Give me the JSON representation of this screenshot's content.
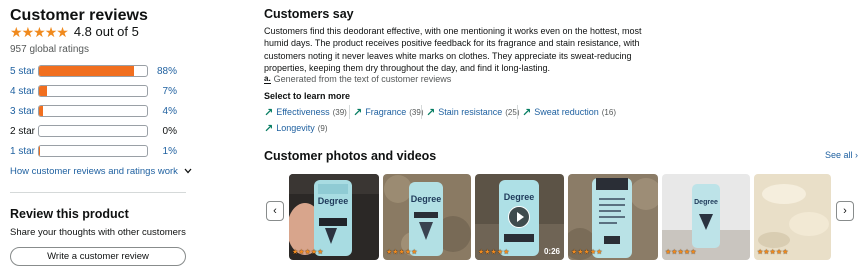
{
  "summary": {
    "title": "Customer reviews",
    "rating_value": 4.8,
    "rating_text": "4.8 out of 5",
    "global_ratings": "957 global ratings",
    "stars": [
      "★",
      "★",
      "★",
      "★",
      "★"
    ]
  },
  "histogram": [
    {
      "label": "5 star",
      "percent": 88,
      "percent_text": "88%"
    },
    {
      "label": "4 star",
      "percent": 7,
      "percent_text": "7%"
    },
    {
      "label": "3 star",
      "percent": 4,
      "percent_text": "4%"
    },
    {
      "label": "2 star",
      "percent": 0,
      "percent_text": "0%"
    },
    {
      "label": "1 star",
      "percent": 1,
      "percent_text": "1%"
    }
  ],
  "how_link": "How customer reviews and ratings work",
  "review_product": {
    "title": "Review this product",
    "subtitle": "Share your thoughts with other customers",
    "button_label": "Write a customer review"
  },
  "customers_say": {
    "title": "Customers say",
    "body": "Customers find this deodorant effective, with one mentioning it works even on the hottest, most humid days. The product receives positive feedback for its fragrance and stain resistance, with customers noting it never leaves white marks on clothes. They appreciate its sweat-reducing properties, keeping them dry throughout the day, and find it long-lasting.",
    "ai_icon": "a.",
    "generated_text": "Generated from the text of customer reviews",
    "select_label": "Select to learn more",
    "chips": [
      {
        "label": "Effectiveness",
        "count": "(39)"
      },
      {
        "label": "Fragrance",
        "count": "(39)"
      },
      {
        "label": "Stain resistance",
        "count": "(25)"
      },
      {
        "label": "Sweat reduction",
        "count": "(16)"
      },
      {
        "label": "Longevity",
        "count": "(9)"
      }
    ]
  },
  "photos": {
    "title": "Customer photos and videos",
    "see_all": "See all ›",
    "prev_icon": "‹",
    "next_icon": "›",
    "items": [
      {
        "stars": "★★★★★",
        "duration": "",
        "label": "Degree"
      },
      {
        "stars": "★★★★★",
        "duration": "",
        "label": "Degree"
      },
      {
        "stars": "★★★★★",
        "duration": "0:26",
        "label": "Degree"
      },
      {
        "stars": "★★★★★",
        "duration": "",
        "label": ""
      },
      {
        "stars": "★★★★★",
        "duration": "",
        "label": "Degree"
      },
      {
        "stars": "★★★★★",
        "duration": "",
        "label": ""
      }
    ]
  },
  "colors": {
    "star": "#f08a1e",
    "bar_fill": "#f16f1f",
    "link": "#2162a1",
    "chip_arrow": "#067d62"
  }
}
